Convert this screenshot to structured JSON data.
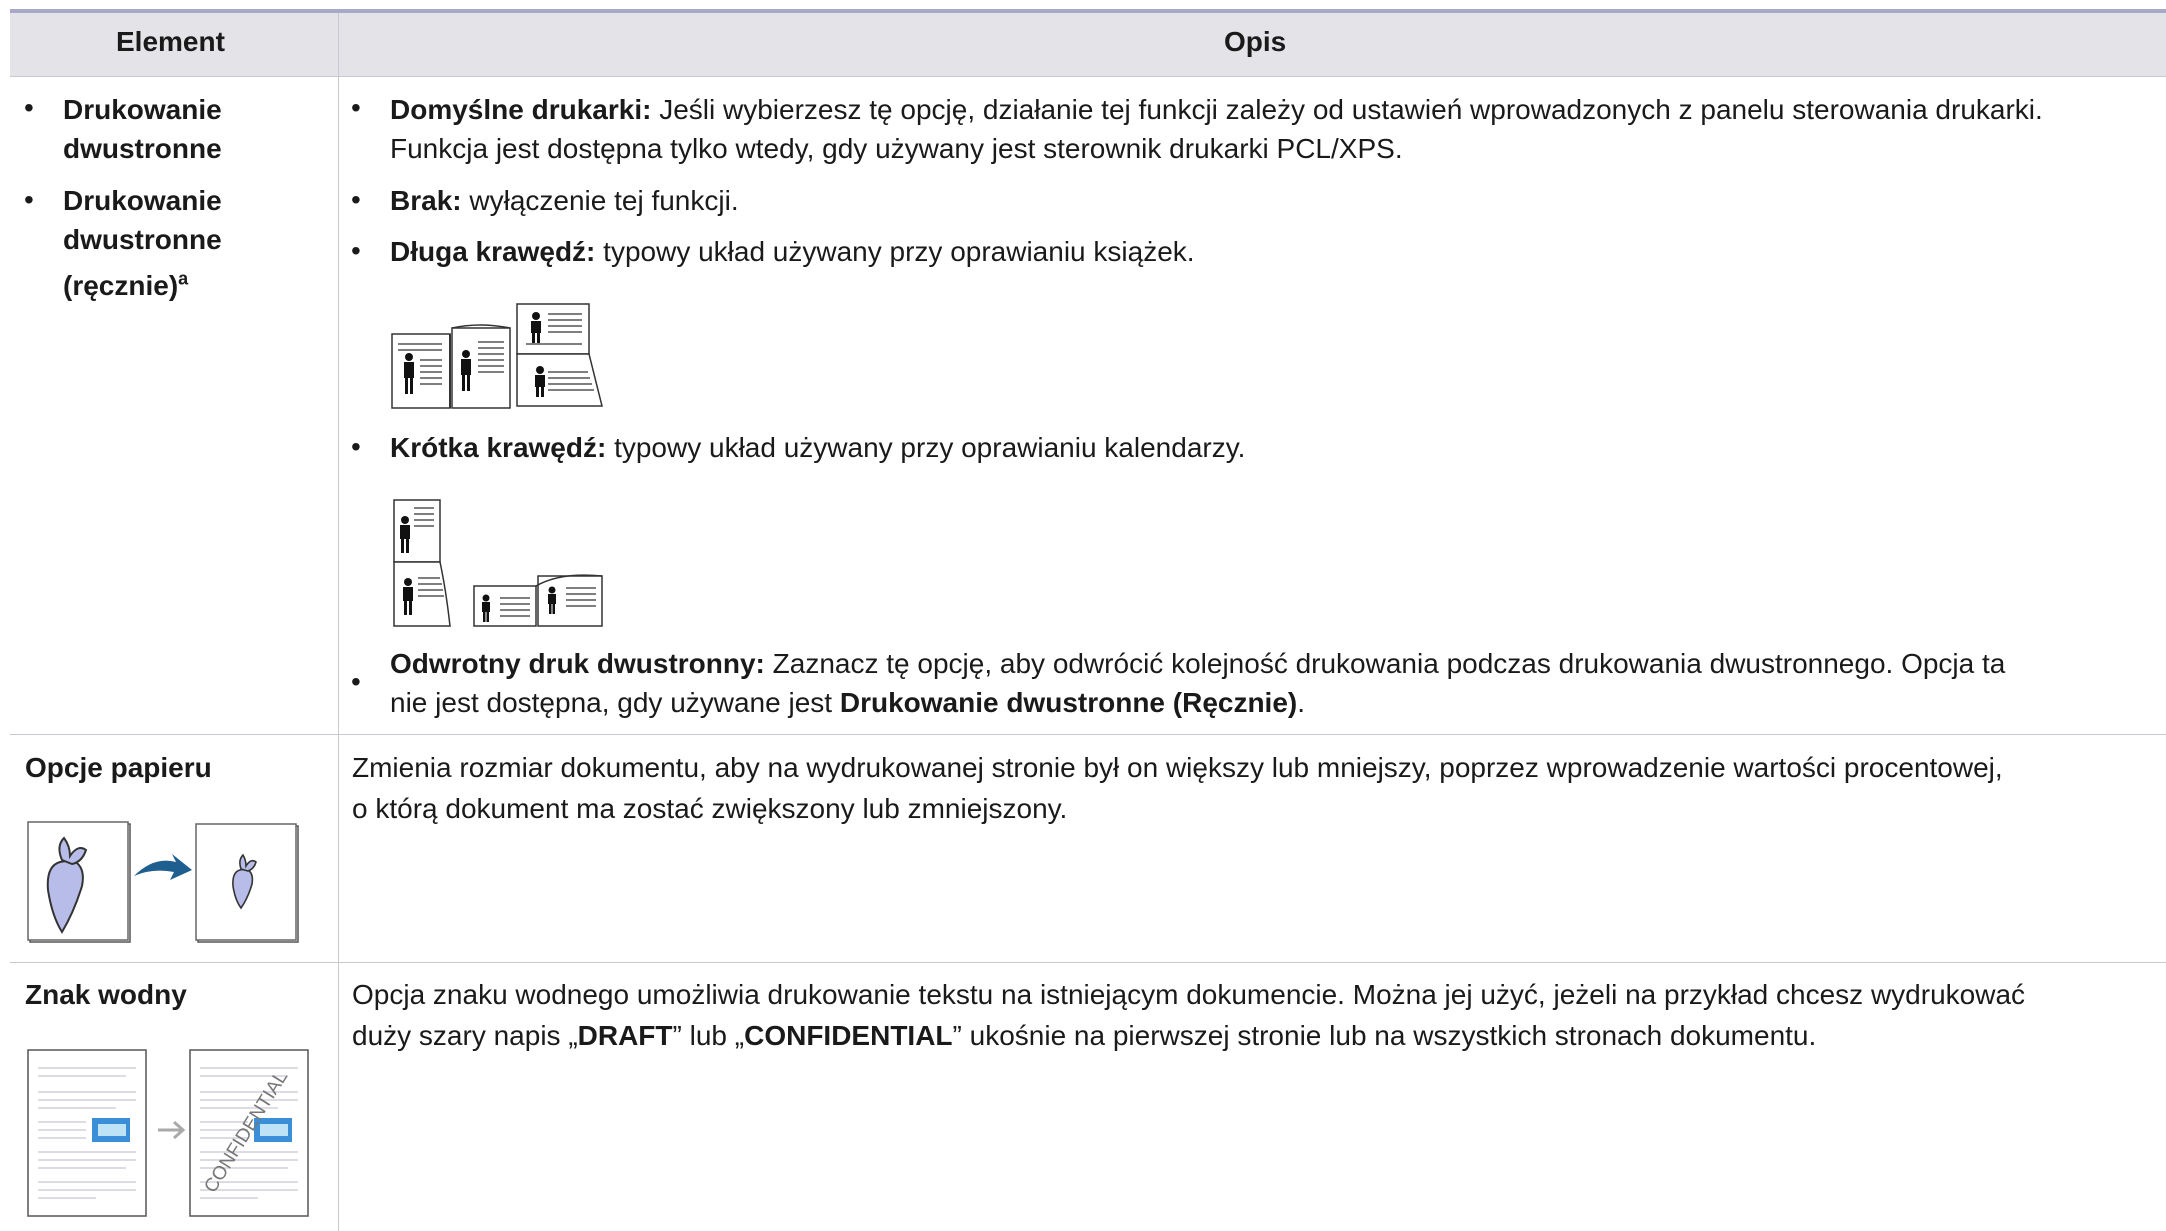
{
  "table": {
    "headers": {
      "element": "Element",
      "desc": "Opis"
    },
    "row1": {
      "items": [
        "Drukowanie",
        "dwustronne",
        "Drukowanie",
        "dwustronne",
        "(ręcznie)"
      ],
      "footnote_mark": "a",
      "opt_default_label": "Domyślne drukarki:",
      "opt_default_text1": " Jeśli wybierzesz tę opcję, działanie tej funkcji zależy od ustawień wprowadzonych z panelu sterowania drukarki.",
      "opt_default_text2": "Funkcja jest dostępna tylko wtedy, gdy używany jest sterownik drukarki PCL/XPS.",
      "opt_none_label": "Brak:",
      "opt_none_text": " wyłączenie tej funkcji.",
      "opt_long_label": "Długa krawędź:",
      "opt_long_text": " typowy układ używany przy oprawianiu książek.",
      "opt_short_label": "Krótka krawędź:",
      "opt_short_text": " typowy układ używany przy oprawianiu kalendarzy.",
      "opt_reverse_label": "Odwrotny druk dwustronny:",
      "opt_reverse_text1": " Zaznacz tę opcję, aby odwrócić kolejność drukowania podczas drukowania dwustronnego. Opcja ta",
      "opt_reverse_text2a": "nie jest dostępna, gdy używane jest ",
      "opt_reverse_text2b": "Drukowanie dwustronne (Ręcznie)",
      "opt_reverse_text2c": "."
    },
    "row2": {
      "title": "Opcje papieru",
      "desc1": "Zmienia rozmiar dokumentu, aby na wydrukowanej stronie był on większy lub mniejszy, poprzez wprowadzenie wartości procentowej,",
      "desc2": "o którą dokument ma zostać zwiększony lub zmniejszony."
    },
    "row3": {
      "title": "Znak wodny",
      "desc1": "Opcja znaku wodnego umożliwia drukowanie tekstu na istniejącym dokumencie. Można jej użyć, jeżeli na przykład chcesz wydrukować",
      "desc2a": "duży szary napis „",
      "desc2b": "DRAFT",
      "desc2c": "” lub „",
      "desc2d": "CONFIDENTIAL",
      "desc2e": "” ukośnie na pierwszej stronie lub na wszystkich stronach dokumentu.",
      "watermark_text": "CONFIDENTIAL"
    }
  },
  "colors": {
    "header_bg": "#e3e3e8",
    "top_rule": "#a8a8c8",
    "grid": "#c8c8d0",
    "arrow_blue": "#1f5f8f"
  },
  "icons": [
    "booklet-long-edge-icon",
    "booklet-short-edge-icon",
    "carrot-scale-icon",
    "watermark-icon"
  ]
}
